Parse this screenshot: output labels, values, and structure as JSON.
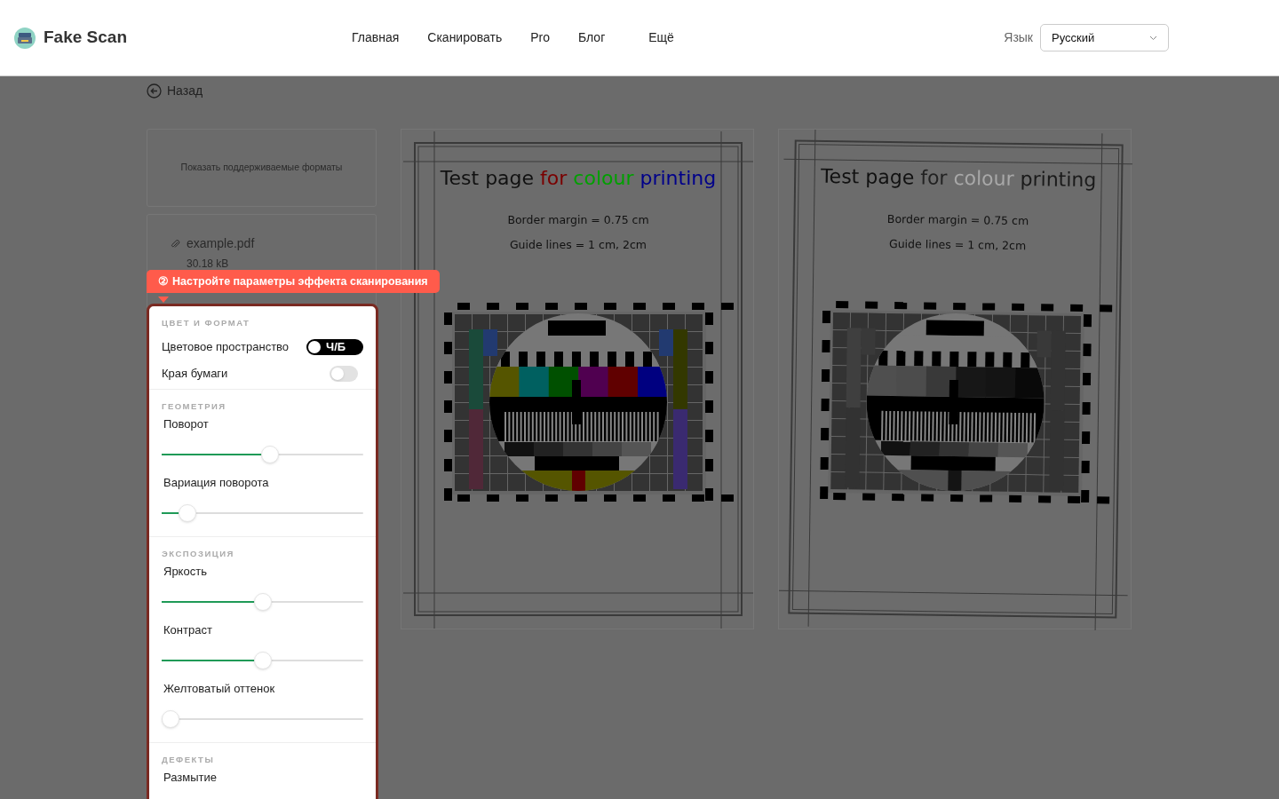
{
  "header": {
    "logo": "Fake Scan",
    "nav": [
      "Главная",
      "Сканировать",
      "Pro",
      "Блог",
      "Ещё"
    ],
    "language_label": "Язык",
    "language": "Русский"
  },
  "back_link": "Назад",
  "formats_card": {
    "label": "Показать поддерживаемые форматы"
  },
  "file_card": {
    "name": "example.pdf",
    "size": "30.18 kB"
  },
  "tooltip": {
    "step": "②",
    "text": "Настройте параметры эффекта сканирования"
  },
  "settings": [
    {
      "heading": "ЦВЕТ И ФОРМАТ",
      "items": [
        {
          "kind": "toggle",
          "label": "Цветовое пространство",
          "on": true,
          "value": "Ч/Б"
        },
        {
          "kind": "toggle",
          "label": "Края бумаги",
          "on": false
        }
      ]
    },
    {
      "heading": "ГЕОМЕТРИЯ",
      "items": [
        {
          "kind": "slider",
          "label": "Поворот",
          "level": 0.54
        },
        {
          "kind": "slider",
          "label": "Вариация поворота",
          "level": 0.09
        }
      ]
    },
    {
      "heading": "ЭКСПОЗИЦИЯ",
      "items": [
        {
          "kind": "slider",
          "label": "Яркость",
          "level": 0.5
        },
        {
          "kind": "slider",
          "label": "Контраст",
          "level": 0.5
        },
        {
          "kind": "slider",
          "label": "Желтоватый оттенок",
          "level": 0.0
        }
      ]
    },
    {
      "heading": "ДЕФЕКТЫ",
      "items": [
        {
          "kind": "label",
          "label": "Размытие"
        }
      ]
    }
  ],
  "previews": [
    {
      "monochrome": false,
      "title": [
        {
          "text": "Test page",
          "color": "#111111"
        },
        {
          "text": "for",
          "color": "#7a0000"
        },
        {
          "text": "colour",
          "color": "#00a000"
        },
        {
          "text": "printing",
          "color": "#00008a"
        }
      ],
      "lines": [
        "Border margin = 0.75 cm",
        "Guide lines = 1 cm, 2cm"
      ]
    },
    {
      "monochrome": true,
      "title": [
        {
          "text": "Test page",
          "color": "#111111"
        },
        {
          "text": "for",
          "color": "#222222"
        },
        {
          "text": "colour",
          "color": "#a8a8a8"
        },
        {
          "text": "printing",
          "color": "#1a1a1a"
        }
      ],
      "lines": [
        "Border margin = 0.75 cm",
        "Guide lines = 1 cm, 2cm"
      ]
    }
  ]
}
